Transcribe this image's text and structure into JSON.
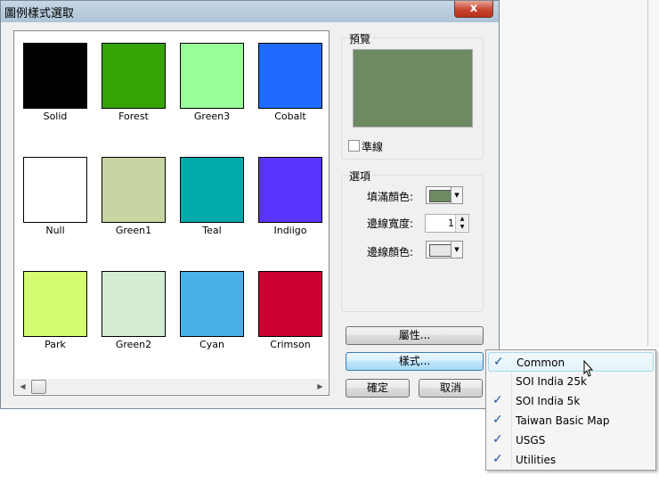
{
  "window": {
    "title": "圖例樣式選取",
    "close_glyph": "x"
  },
  "swatches": [
    {
      "label": "Solid",
      "color": "#000000"
    },
    {
      "label": "Forest",
      "color": "#36a306"
    },
    {
      "label": "Green3",
      "color": "#99fe99"
    },
    {
      "label": "Cobalt",
      "color": "#1f6bff"
    },
    {
      "label": "Null",
      "color": "#ffffff"
    },
    {
      "label": "Green1",
      "color": "#c7d5a2"
    },
    {
      "label": "Teal",
      "color": "#00aaaa"
    },
    {
      "label": "Indiigo",
      "color": "#5b33ff"
    },
    {
      "label": "Park",
      "color": "#d5fb73"
    },
    {
      "label": "Green2",
      "color": "#d3ecd3"
    },
    {
      "label": "Cyan",
      "color": "#48b2e8"
    },
    {
      "label": "Crimson",
      "color": "#cc0033"
    }
  ],
  "preview": {
    "title": "預覽",
    "color": "#6e8a63",
    "checkbox_label": "準線",
    "checked": false
  },
  "options": {
    "title": "選項",
    "fill_color_label": "填滿顏色:",
    "fill_color": "#6e8a63",
    "border_width_label": "邊線寬度:",
    "border_width_value": "1",
    "border_color_label": "邊線顏色:",
    "border_color": "#e6e6e6"
  },
  "buttons": {
    "properties": "屬性...",
    "style": "樣式...",
    "ok": "確定",
    "cancel": "取消"
  },
  "style_menu": {
    "items": [
      {
        "label": "Common",
        "checked": true,
        "highlighted": true
      },
      {
        "label": "SOI India 25k",
        "checked": false,
        "highlighted": false
      },
      {
        "label": "SOI India 5k",
        "checked": true,
        "highlighted": false
      },
      {
        "label": "Taiwan Basic Map",
        "checked": true,
        "highlighted": false
      },
      {
        "label": "USGS",
        "checked": true,
        "highlighted": false
      },
      {
        "label": "Utilities",
        "checked": true,
        "highlighted": false
      }
    ]
  }
}
